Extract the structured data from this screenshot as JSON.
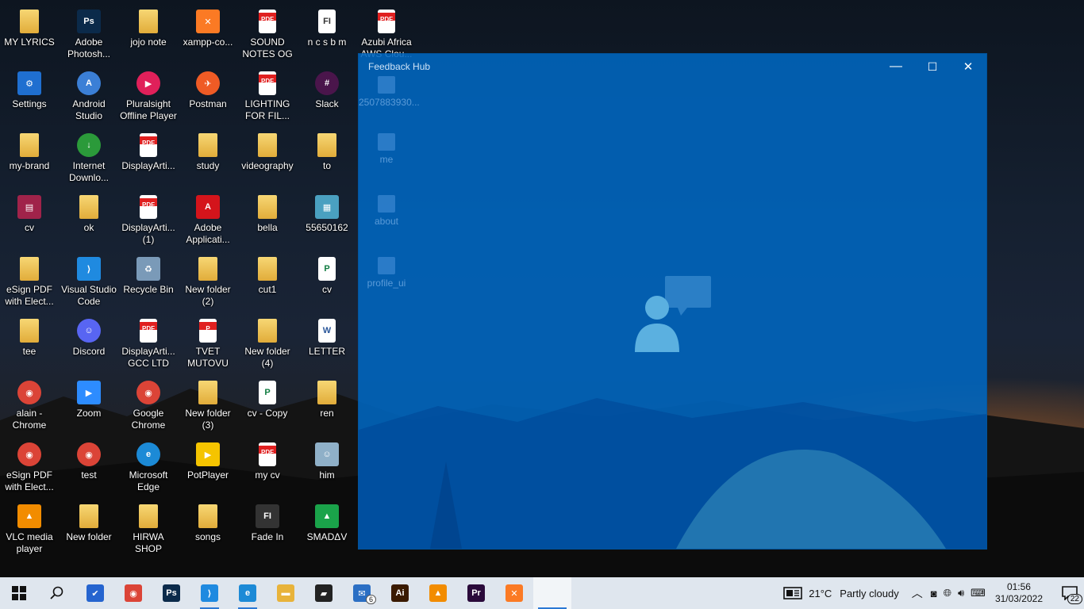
{
  "desktop": {
    "icons": [
      {
        "label": "MY LYRICS",
        "type": "folder",
        "glyph": ""
      },
      {
        "label": "Settings",
        "type": "app",
        "glyph": "⚙",
        "color": "#1f6fd0"
      },
      {
        "label": "my-brand",
        "type": "folder",
        "glyph": ""
      },
      {
        "label": "cv",
        "type": "app",
        "glyph": "▤",
        "color": "#a0234a"
      },
      {
        "label": "eSign PDF\nwith Elect...",
        "type": "folder",
        "glyph": ""
      },
      {
        "label": "tee",
        "type": "folder",
        "glyph": ""
      },
      {
        "label": "alain -\nChrome",
        "type": "round",
        "glyph": "◉",
        "color": "#db4437"
      },
      {
        "label": "eSign PDF\nwith Elect...",
        "type": "round",
        "glyph": "◉",
        "color": "#db4437"
      },
      {
        "label": "VLC media\nplayer",
        "type": "app",
        "glyph": "▲",
        "color": "#f28c00"
      },
      {
        "label": "Adobe\nPhotosh...",
        "type": "app",
        "glyph": "Ps",
        "color": "#0b2a4a"
      },
      {
        "label": "Android\nStudio",
        "type": "round",
        "glyph": "A",
        "color": "#3b7fd6"
      },
      {
        "label": "Internet\nDownlo...",
        "type": "round",
        "glyph": "↓",
        "color": "#2b9a3a"
      },
      {
        "label": "ok",
        "type": "folder",
        "glyph": ""
      },
      {
        "label": "Visual Studio\nCode",
        "type": "app",
        "glyph": "⟩",
        "color": "#1f8ae0"
      },
      {
        "label": "Discord",
        "type": "round",
        "glyph": "☺",
        "color": "#5865f2"
      },
      {
        "label": "Zoom",
        "type": "app",
        "glyph": "▶",
        "color": "#2d8cff"
      },
      {
        "label": "test",
        "type": "round",
        "glyph": "◉",
        "color": "#db4437"
      },
      {
        "label": "New folder",
        "type": "folder",
        "glyph": ""
      },
      {
        "label": "jojo note",
        "type": "folder",
        "glyph": ""
      },
      {
        "label": "Pluralsight\nOffline Player",
        "type": "round",
        "glyph": "▶",
        "color": "#e0205a"
      },
      {
        "label": "DisplayArti...",
        "type": "pdf",
        "glyph": "PDF"
      },
      {
        "label": "DisplayArti...\n(1)",
        "type": "pdf",
        "glyph": "PDF"
      },
      {
        "label": "Recycle Bin",
        "type": "app",
        "glyph": "♻",
        "color": "#7a9ab8"
      },
      {
        "label": "DisplayArti...\nGCC LTD",
        "type": "pdf",
        "glyph": "PDF"
      },
      {
        "label": "Google\nChrome",
        "type": "round",
        "glyph": "◉",
        "color": "#db4437"
      },
      {
        "label": "Microsoft\nEdge",
        "type": "round",
        "glyph": "e",
        "color": "#1c8ad6"
      },
      {
        "label": "HIRWA\nSHOP",
        "type": "folder",
        "glyph": ""
      },
      {
        "label": "xampp-co...",
        "type": "app",
        "glyph": "✕",
        "color": "#fb7a24"
      },
      {
        "label": "Postman",
        "type": "round",
        "glyph": "✈",
        "color": "#ef5b25"
      },
      {
        "label": "study",
        "type": "folder",
        "glyph": ""
      },
      {
        "label": "Adobe\nApplicati...",
        "type": "app",
        "glyph": "A",
        "color": "#d4141b"
      },
      {
        "label": "New folder\n(2)",
        "type": "folder",
        "glyph": ""
      },
      {
        "label": "TVET\nMUTOVU",
        "type": "pdf",
        "glyph": "P"
      },
      {
        "label": "New folder\n(3)",
        "type": "folder",
        "glyph": ""
      },
      {
        "label": "PotPlayer",
        "type": "app",
        "glyph": "▶",
        "color": "#f5c400"
      },
      {
        "label": "songs",
        "type": "folder",
        "glyph": ""
      },
      {
        "label": "SOUND\nNOTES  OG",
        "type": "pdf",
        "glyph": "PDF"
      },
      {
        "label": "LIGHTING\nFOR FIL...",
        "type": "pdf",
        "glyph": "PDF"
      },
      {
        "label": "videography",
        "type": "folder",
        "glyph": ""
      },
      {
        "label": "bella",
        "type": "folder",
        "glyph": ""
      },
      {
        "label": "cut1",
        "type": "folder",
        "glyph": ""
      },
      {
        "label": "New folder\n(4)",
        "type": "folder",
        "glyph": ""
      },
      {
        "label": "cv - Copy",
        "type": "doc",
        "glyph": "P",
        "color": "#107c41"
      },
      {
        "label": "my cv",
        "type": "pdf",
        "glyph": "PDF"
      },
      {
        "label": "Fade In",
        "type": "app",
        "glyph": "FI",
        "color": "#333"
      },
      {
        "label": "n c s b m",
        "type": "doc",
        "glyph": "FI",
        "color": "#333"
      },
      {
        "label": "Slack",
        "type": "round",
        "glyph": "#",
        "color": "#4a154b"
      },
      {
        "label": "to",
        "type": "folder",
        "glyph": ""
      },
      {
        "label": "55650162",
        "type": "app",
        "glyph": "▦",
        "color": "#4aa0c0"
      },
      {
        "label": "cv",
        "type": "doc",
        "glyph": "P",
        "color": "#107c41"
      },
      {
        "label": "LETTER",
        "type": "doc",
        "glyph": "W",
        "color": "#2b579a"
      },
      {
        "label": "ren",
        "type": "folder",
        "glyph": ""
      },
      {
        "label": "him",
        "type": "app",
        "glyph": "☺",
        "color": "#8fb0c8"
      },
      {
        "label": "SMADΔV",
        "type": "app",
        "glyph": "▲",
        "color": "#1aa34a"
      },
      {
        "label": "Azubi Africa\nAWS Clou...",
        "type": "pdf",
        "glyph": "PDF"
      }
    ]
  },
  "feedback_hub": {
    "title": "Feedback Hub",
    "minimize": "—",
    "maximize": "☐",
    "close": "✕",
    "ghost_items": [
      {
        "label": "2507883930..."
      },
      {
        "label": "me"
      },
      {
        "label": "about"
      },
      {
        "label": "profile_ui"
      }
    ]
  },
  "taskbar": {
    "start": "⊞",
    "search": "⚲",
    "apps": [
      {
        "name": "todo",
        "glyph": "✔",
        "color": "#2564cf",
        "state": ""
      },
      {
        "name": "chrome",
        "glyph": "◉",
        "color": "#db4437",
        "state": ""
      },
      {
        "name": "photoshop",
        "glyph": "Ps",
        "color": "#0b2a4a",
        "state": ""
      },
      {
        "name": "vscode",
        "glyph": "⟩",
        "color": "#1f8ae0",
        "state": "open"
      },
      {
        "name": "edge",
        "glyph": "e",
        "color": "#1c8ad6",
        "state": "open"
      },
      {
        "name": "file-explorer",
        "glyph": "▬",
        "color": "#e8b33a",
        "state": ""
      },
      {
        "name": "sticky-notes",
        "glyph": "▰",
        "color": "#222",
        "state": ""
      },
      {
        "name": "mail",
        "glyph": "✉",
        "color": "#2b6fc4",
        "state": "",
        "badge": "6"
      },
      {
        "name": "illustrator",
        "glyph": "Ai",
        "color": "#3a1a00",
        "state": ""
      },
      {
        "name": "vlc",
        "glyph": "▲",
        "color": "#f28c00",
        "state": ""
      },
      {
        "name": "premiere",
        "glyph": "Pr",
        "color": "#2a0a3a",
        "state": ""
      },
      {
        "name": "xampp",
        "glyph": "✕",
        "color": "#fb7a24",
        "state": ""
      },
      {
        "name": "feedback-hub",
        "glyph": "",
        "color": "#ffffff",
        "state": "active"
      }
    ],
    "weather": {
      "temp": "21°C",
      "desc": "Partly cloudy"
    },
    "clock": {
      "time": "01:56",
      "date": "31/03/2022"
    },
    "notifications": "22"
  }
}
